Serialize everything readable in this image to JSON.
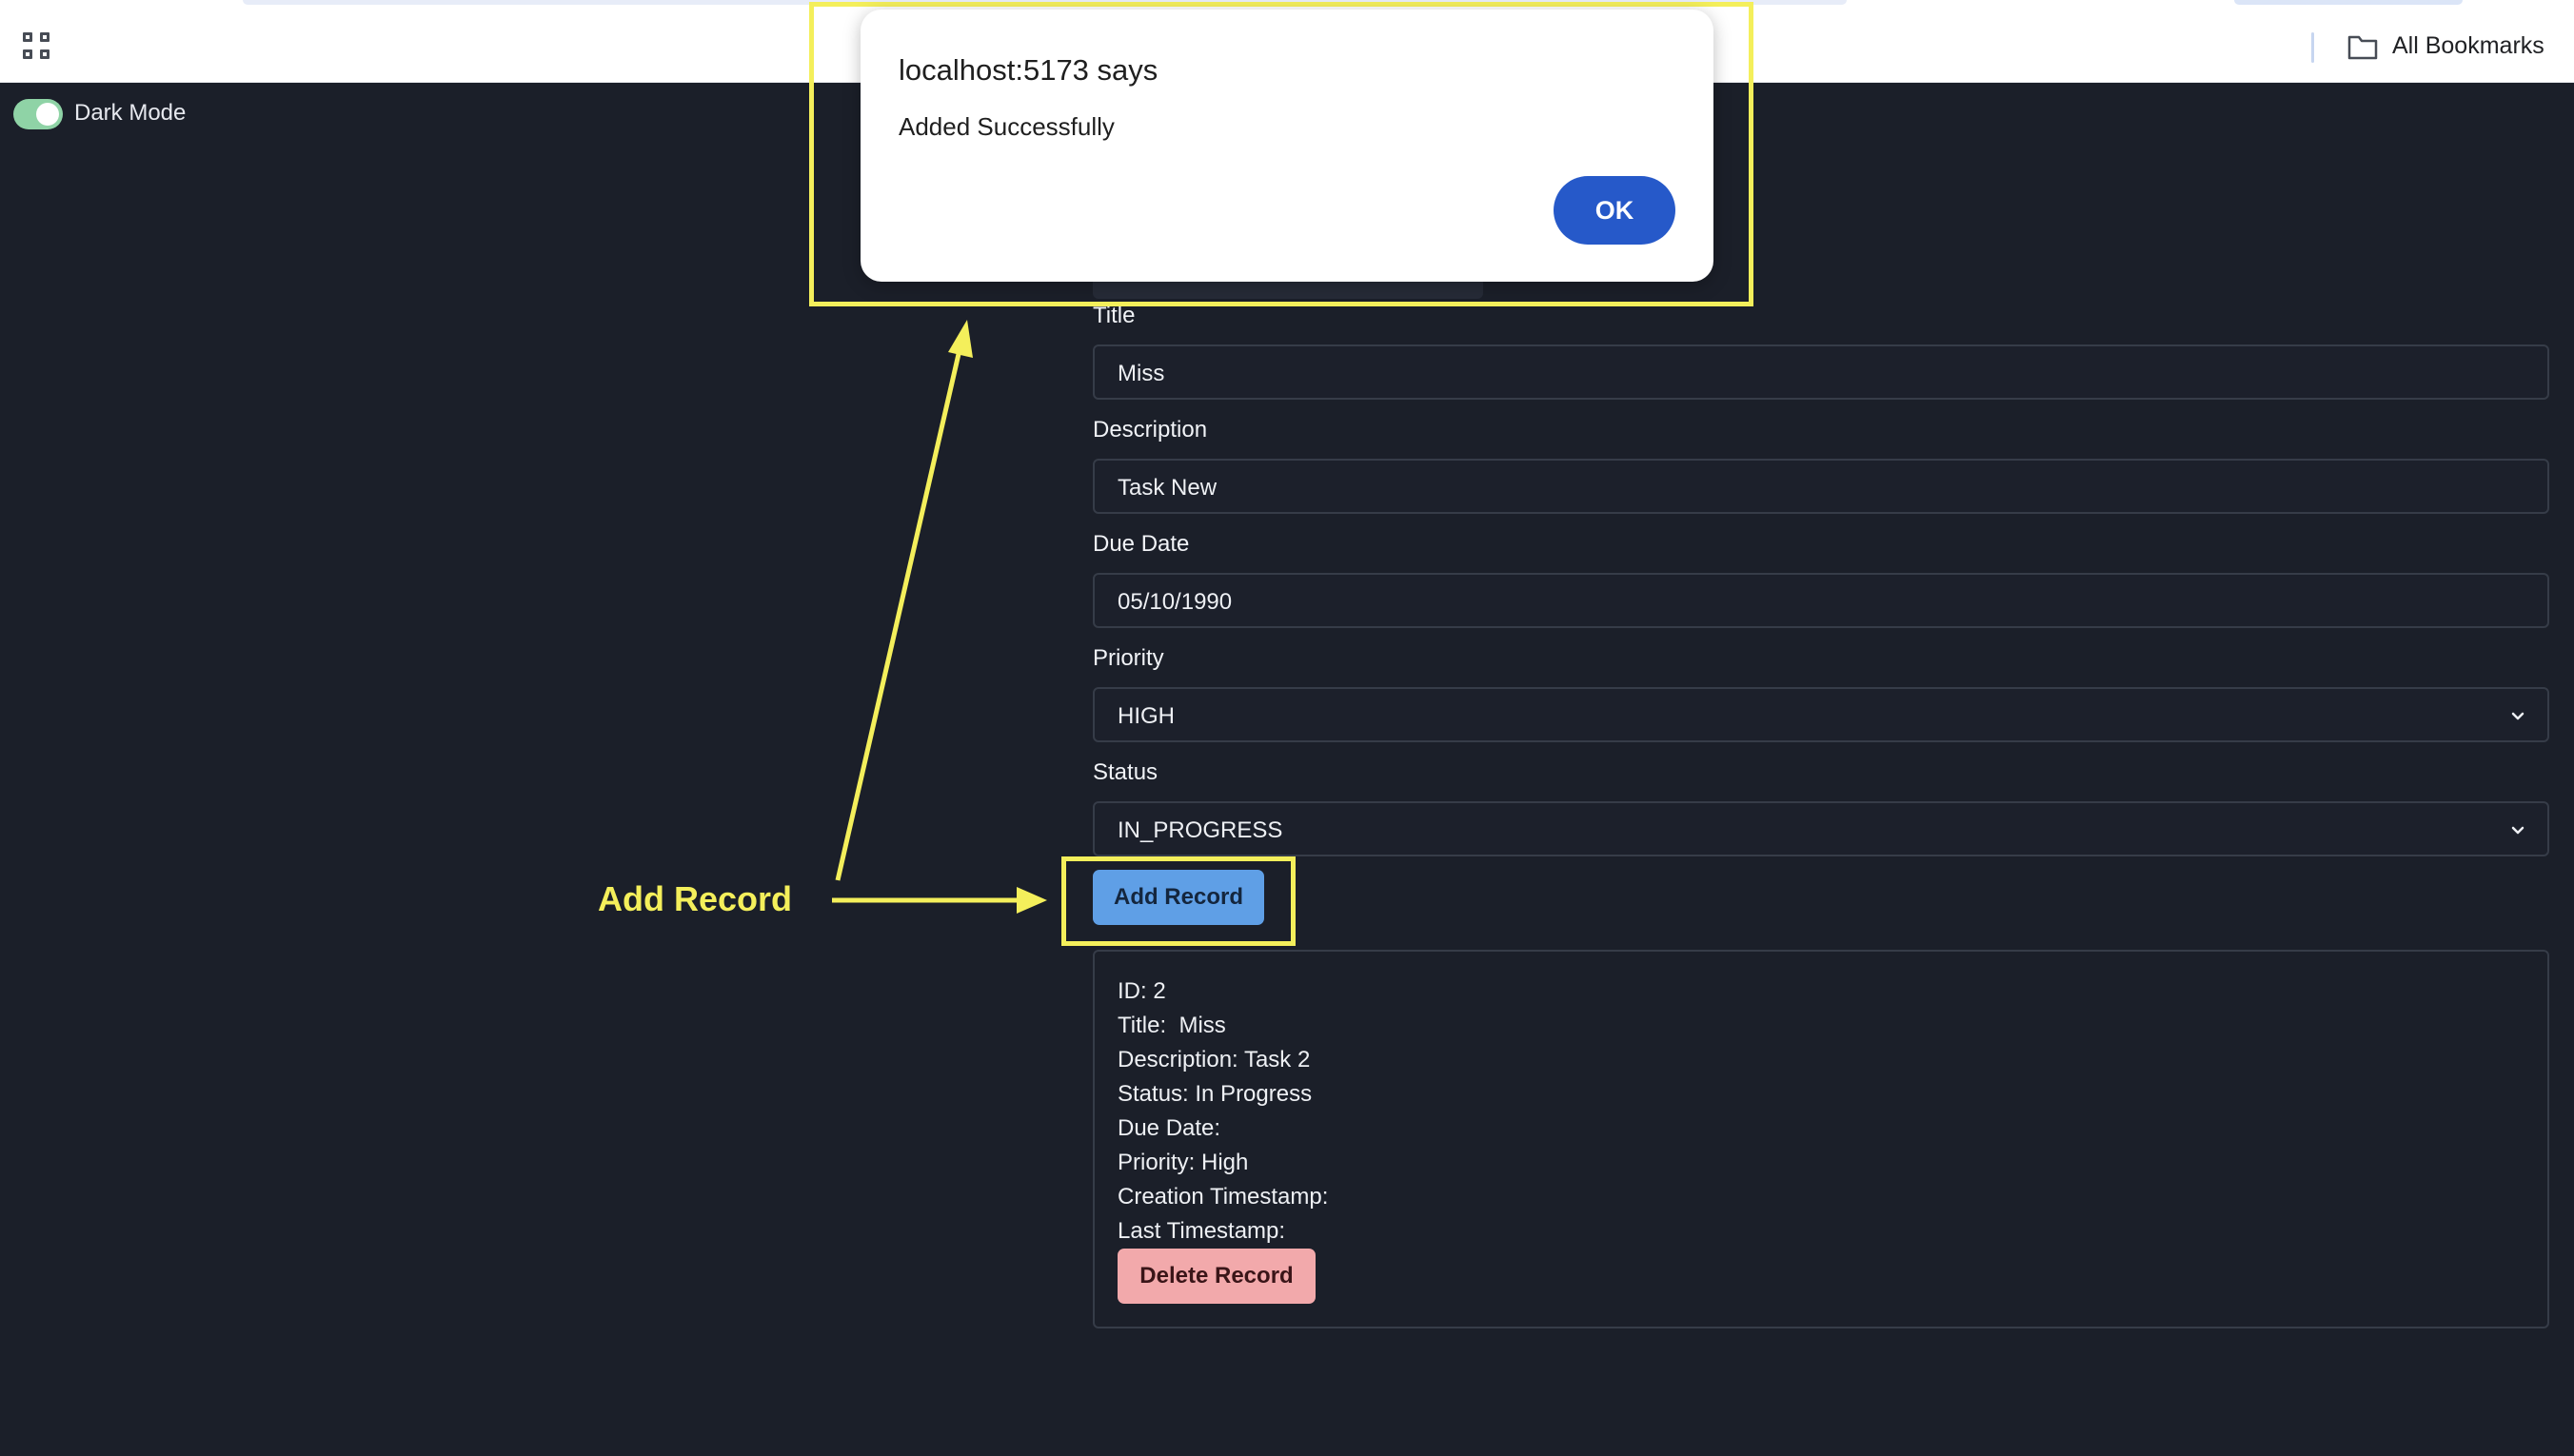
{
  "browser": {
    "bookmarks_label": "All Bookmarks"
  },
  "app": {
    "dark_mode_label": "Dark Mode",
    "dark_mode_on": true
  },
  "form": {
    "title_label": "Title",
    "title_value": "Miss",
    "description_label": "Description",
    "description_value": "Task New",
    "due_date_label": "Due Date",
    "due_date_value": "05/10/1990",
    "priority_label": "Priority",
    "priority_value": "HIGH",
    "status_label": "Status",
    "status_value": "IN_PROGRESS",
    "add_button": "Add Record"
  },
  "record": {
    "lines": [
      "ID: 2",
      "Title:  Miss",
      "Description: Task 2",
      "Status: In Progress",
      "Due Date:",
      "Priority: High",
      "Creation Timestamp:",
      "Last Timestamp:"
    ],
    "delete_button": "Delete Record"
  },
  "dialog": {
    "title": "localhost:5173 says",
    "message": "Added Successfully",
    "ok_button": "OK"
  },
  "annotation": {
    "label": "Add Record",
    "color": "#f4ef5b"
  }
}
